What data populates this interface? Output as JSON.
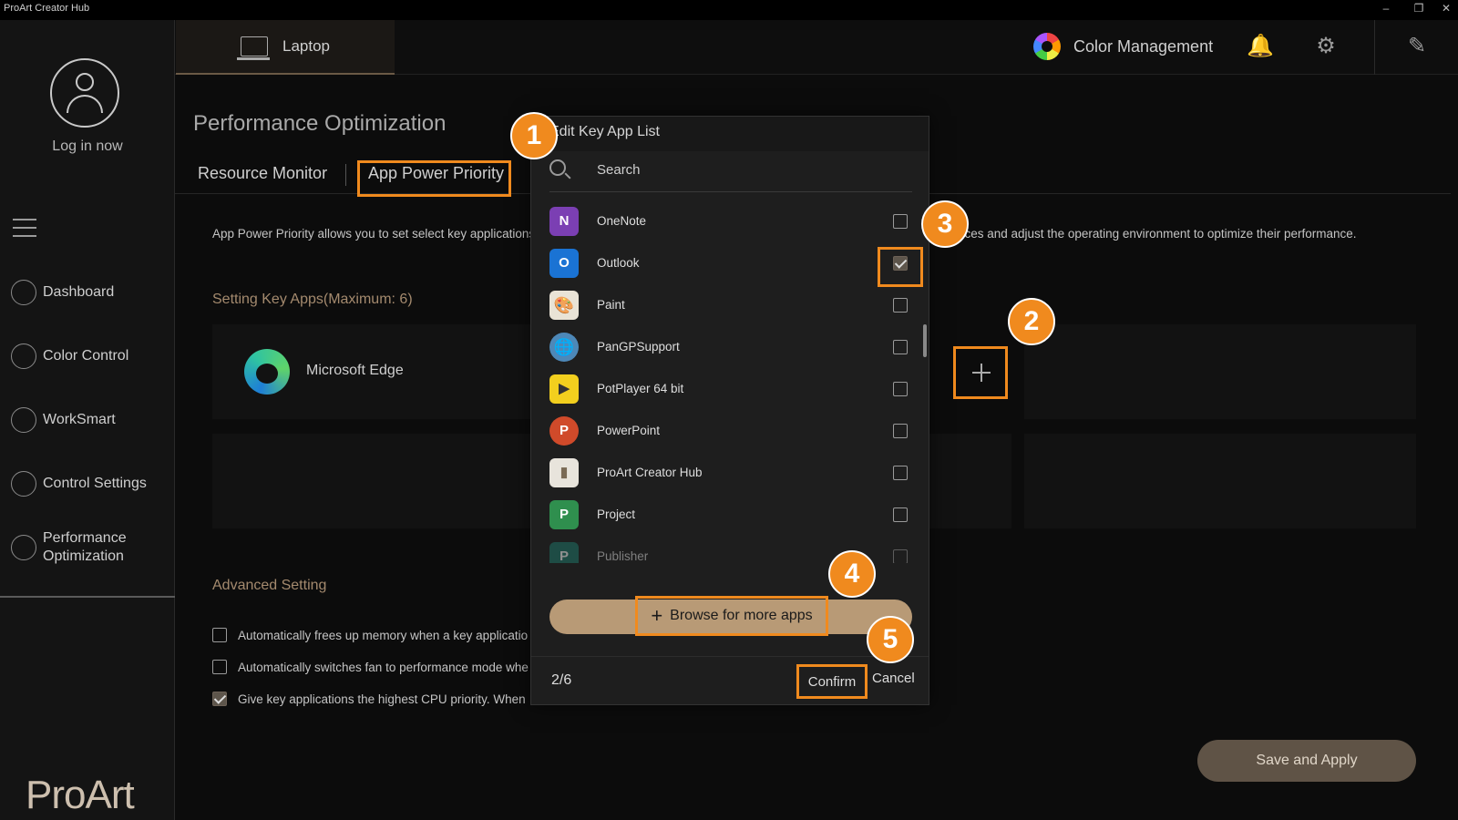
{
  "window": {
    "title": "ProArt Creator Hub",
    "min": "–",
    "restore": "❐",
    "close": "✕"
  },
  "sidebar": {
    "login": "Log in now",
    "items": [
      {
        "label": "Dashboard",
        "icon": "dashboard-icon"
      },
      {
        "label": "Color Control",
        "icon": "color-control-icon"
      },
      {
        "label": "WorkSmart",
        "icon": "worksmart-icon"
      },
      {
        "label": "Control Settings",
        "icon": "control-settings-icon"
      },
      {
        "label": "Performance Optimization",
        "icon": "performance-icon"
      }
    ],
    "brand": "ProArt"
  },
  "topbar": {
    "device": "Laptop",
    "color_management": "Color Management",
    "bell": "🔔",
    "gear": "⚙",
    "feedback": "✎"
  },
  "main": {
    "title": "Performance Optimization",
    "tabs": [
      {
        "label": "Resource Monitor"
      },
      {
        "label": "App Power Priority"
      }
    ],
    "description": "App Power Priority allows you to set select key applications",
    "description_tail": "rces and adjust the operating environment to optimize their performance.",
    "key_apps_title": "Setting Key Apps(Maximum: 6)",
    "key_apps": [
      {
        "name": "Microsoft Edge"
      }
    ],
    "advanced_title": "Advanced Setting",
    "advanced": [
      {
        "label": "Automatically frees up memory when a key applicatio",
        "checked": false
      },
      {
        "label": "Automatically switches fan to performance mode whe",
        "checked": false
      },
      {
        "label": "Give key applications the highest CPU priority. When a",
        "checked": true
      }
    ],
    "save": "Save and Apply"
  },
  "modal": {
    "title": "Edit Key App List",
    "search_placeholder": "Search",
    "apps": [
      {
        "name": "OneNote",
        "checked": false,
        "icon": "onenote-icon",
        "glyph": "N",
        "color": "#7b3fb3"
      },
      {
        "name": "Outlook",
        "checked": true,
        "icon": "outlook-icon",
        "glyph": "O",
        "color": "#1a73d4"
      },
      {
        "name": "Paint",
        "checked": false,
        "icon": "paint-icon",
        "glyph": "🎨",
        "color": "#e9e3d6"
      },
      {
        "name": "PanGPSupport",
        "checked": false,
        "icon": "globe-icon",
        "glyph": "🌐",
        "color": "#4d88b8"
      },
      {
        "name": "PotPlayer 64 bit",
        "checked": false,
        "icon": "potplayer-icon",
        "glyph": "▶",
        "color": "#f2cf1e"
      },
      {
        "name": "PowerPoint",
        "checked": false,
        "icon": "powerpoint-icon",
        "glyph": "P",
        "color": "#d04a2a"
      },
      {
        "name": "ProArt Creator Hub",
        "checked": false,
        "icon": "proart-icon",
        "glyph": "▮",
        "color": "#e8e4dc"
      },
      {
        "name": "Project",
        "checked": false,
        "icon": "project-icon",
        "glyph": "P",
        "color": "#2f8f4e"
      },
      {
        "name": "Publisher",
        "checked": false,
        "icon": "publisher-icon",
        "glyph": "P",
        "color": "#1f7a6c"
      }
    ],
    "browse": "Browse for more apps",
    "count": "2/6",
    "confirm": "Confirm",
    "cancel": "Cancel"
  },
  "badges": [
    "1",
    "2",
    "3",
    "4",
    "5"
  ],
  "colors": {
    "highlight": "#f08a1e",
    "accent": "#b89a76",
    "background": "#0c0c0c"
  }
}
